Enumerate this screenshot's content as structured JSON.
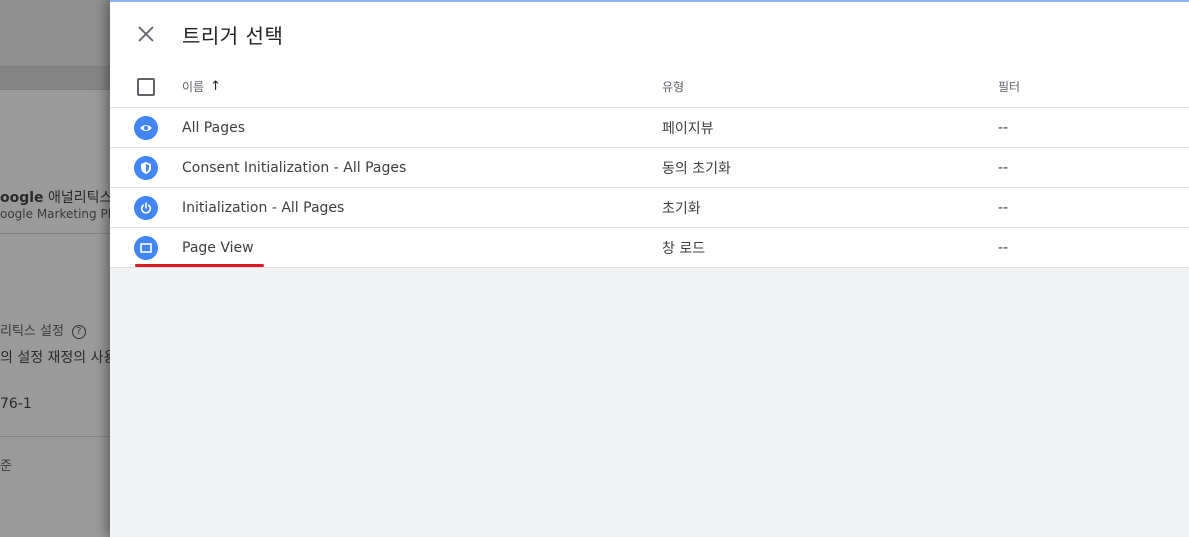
{
  "background": {
    "line1_bold": "oogle",
    "line1_rest": " 애널리틱스",
    "line2": "oogle Marketing Pla",
    "line3": "리틱스 설정",
    "line4": "의 설정 재정의 사용",
    "line5": "76-1",
    "line6": "준"
  },
  "panel": {
    "title": "트리거 선택",
    "columns": {
      "name": "이름",
      "sort_indicator": "↑",
      "type": "유형",
      "filter": "필터"
    },
    "rows": [
      {
        "name": "All Pages",
        "type": "페이지뷰",
        "filter": "--",
        "icon": "eye-icon"
      },
      {
        "name": "Consent Initialization - All Pages",
        "type": "동의 초기화",
        "filter": "--",
        "icon": "shield-icon"
      },
      {
        "name": "Initialization - All Pages",
        "type": "초기화",
        "filter": "--",
        "icon": "power-icon"
      },
      {
        "name": "Page View",
        "type": "창 로드",
        "filter": "--",
        "icon": "window-icon"
      }
    ]
  },
  "colors": {
    "icon_blue": "#4285f4",
    "underline_red": "#e01825"
  }
}
